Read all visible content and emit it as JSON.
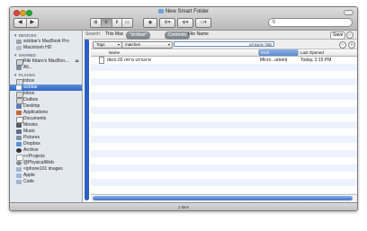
{
  "window": {
    "title": "New Smart Folder"
  },
  "toolbar": {
    "back": "◀",
    "forward": "▶",
    "view_icons": "⊞",
    "view_list": "≡",
    "view_columns": "⫴",
    "view_coverflow": "▭",
    "quicklook": "◉",
    "action": "⚙▾",
    "share": "⊕▾",
    "label": "▭▾",
    "search_placeholder": ""
  },
  "sidebar": {
    "devices_header": "▼ DEVICES",
    "devices": [
      {
        "label": "sickbar's MacBook Pro"
      },
      {
        "label": "Macintosh HD"
      }
    ],
    "shared_header": "▼ SHARED",
    "shared": [
      {
        "label": "Riki Kitaro's MacBoo..."
      },
      {
        "label": "All..."
      }
    ],
    "places_header": "▼ PLACES",
    "places": [
      {
        "label": "Inbox"
      },
      {
        "label": "sickbar"
      },
      {
        "label": "Inbox"
      },
      {
        "label": "Outbox"
      },
      {
        "label": "Desktop"
      },
      {
        "label": "Applications"
      },
      {
        "label": "Documents"
      },
      {
        "label": "Movies"
      },
      {
        "label": "Music"
      },
      {
        "label": "Pictures"
      },
      {
        "label": "Dropbox"
      },
      {
        "label": "Archive"
      },
      {
        "label": "<<Projects"
      },
      {
        "label": "@PhysicalWeb"
      },
      {
        "label": "<iphone101 images"
      },
      {
        "label": "Apple"
      },
      {
        "label": "Code"
      }
    ]
  },
  "search_bar": {
    "search_label": "Search:",
    "scope_this_mac": "This Mac",
    "scope_user": "\"sickbar\"",
    "scope_contents": "Contents",
    "scope_filename": "File Name",
    "save": "Save",
    "minus": "−"
  },
  "criteria": {
    "attribute": "Tags",
    "operator": "matches",
    "value": "ספר אינטרנט",
    "minus": "−",
    "plus": "+"
  },
  "columns": {
    "name": "Name",
    "kind": "Kind",
    "last_opened": "Last Opened"
  },
  "files": [
    {
      "name": "docx.02 אינטרנט גרסה",
      "kind": "Micro...ument",
      "last_opened": "Today, 2:15 PM"
    }
  ],
  "status": {
    "text": "1 item"
  },
  "colors": {
    "accent": "#2f66c4",
    "row_stripe": "#edf3fe"
  }
}
